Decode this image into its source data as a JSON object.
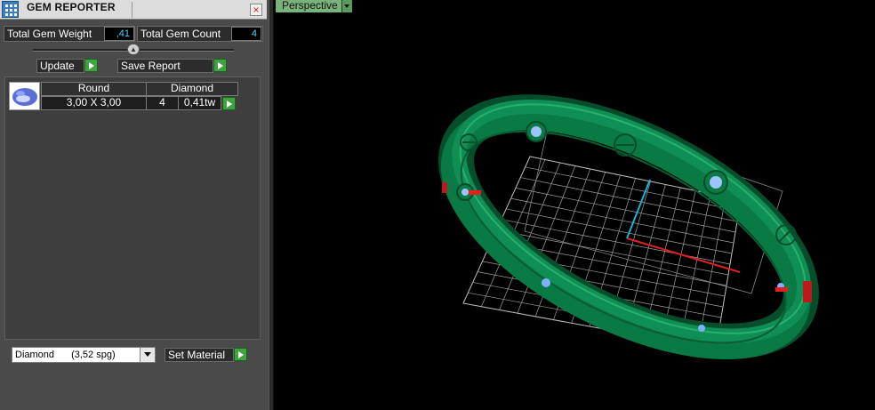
{
  "panel": {
    "title": "GEM REPORTER",
    "close_label": "×",
    "total_weight_label": "Total Gem Weight",
    "total_weight_value": ",41",
    "total_count_label": "Total Gem Count",
    "total_count_value": "4",
    "update_label": "Update",
    "save_report_label": "Save Report"
  },
  "gem_table": {
    "headers": [
      "Round",
      "Diamond"
    ],
    "row": {
      "size": "3,00 X 3,00",
      "count": "4",
      "weight": "0,41tw"
    }
  },
  "material": {
    "name": "Diamond",
    "density": "(3,52 spg)",
    "set_material_label": "Set Material"
  },
  "viewport": {
    "tab_label": "Perspective"
  },
  "colors": {
    "ring_green": "#0a7a45",
    "grid": "#cfcfcf",
    "x_axis": "#e02020",
    "y_axis": "#19b3d6"
  }
}
